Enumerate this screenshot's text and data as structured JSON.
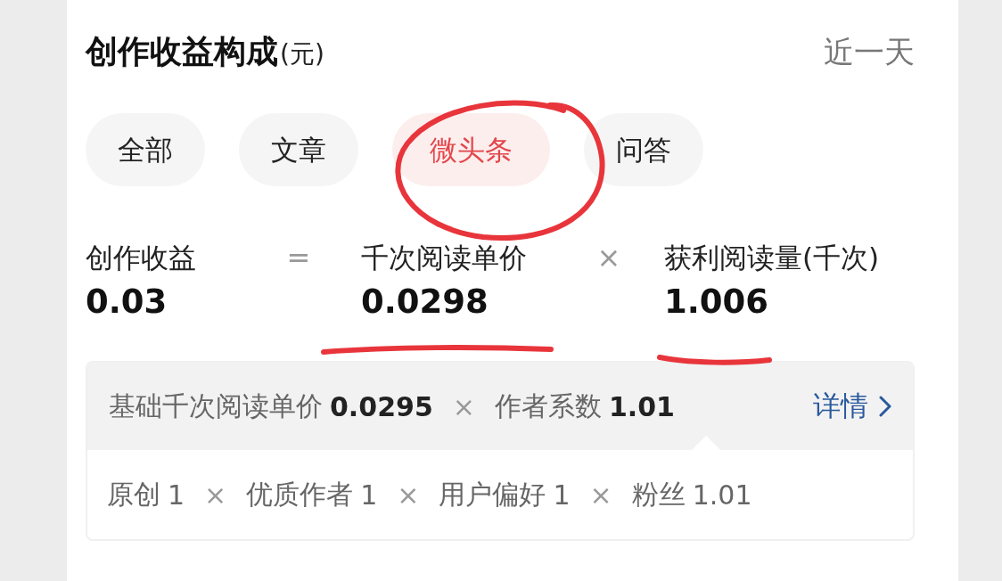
{
  "header": {
    "title": "创作收益构成",
    "unit": "(元)",
    "period": "近一天"
  },
  "tabs": [
    {
      "label": "全部",
      "selected": false
    },
    {
      "label": "文章",
      "selected": false
    },
    {
      "label": "微头条",
      "selected": true
    },
    {
      "label": "问答",
      "selected": false
    }
  ],
  "formula": [
    {
      "kind": "term",
      "label": "创作收益",
      "value": "0.03"
    },
    {
      "kind": "operator",
      "symbol": "="
    },
    {
      "kind": "term",
      "label": "千次阅读单价",
      "value": "0.0298"
    },
    {
      "kind": "operator",
      "symbol": "×"
    },
    {
      "kind": "term",
      "label": "获利阅读量(千次)",
      "value": "1.006"
    }
  ],
  "detail": {
    "factors": [
      {
        "kind": "factor",
        "label": "基础千次阅读单价",
        "value": "0.0295"
      },
      {
        "kind": "operator",
        "symbol": "×"
      },
      {
        "kind": "factor",
        "label": "作者系数",
        "value": "1.01"
      }
    ],
    "link": "详情",
    "coefficients": [
      {
        "kind": "factor",
        "label": "原创",
        "value": "1"
      },
      {
        "kind": "operator",
        "symbol": "×"
      },
      {
        "kind": "factor",
        "label": "优质作者",
        "value": "1"
      },
      {
        "kind": "operator",
        "symbol": "×"
      },
      {
        "kind": "factor",
        "label": "用户偏好",
        "value": "1"
      },
      {
        "kind": "operator",
        "symbol": "×"
      },
      {
        "kind": "factor",
        "label": "粉丝",
        "value": "1.01"
      }
    ]
  }
}
